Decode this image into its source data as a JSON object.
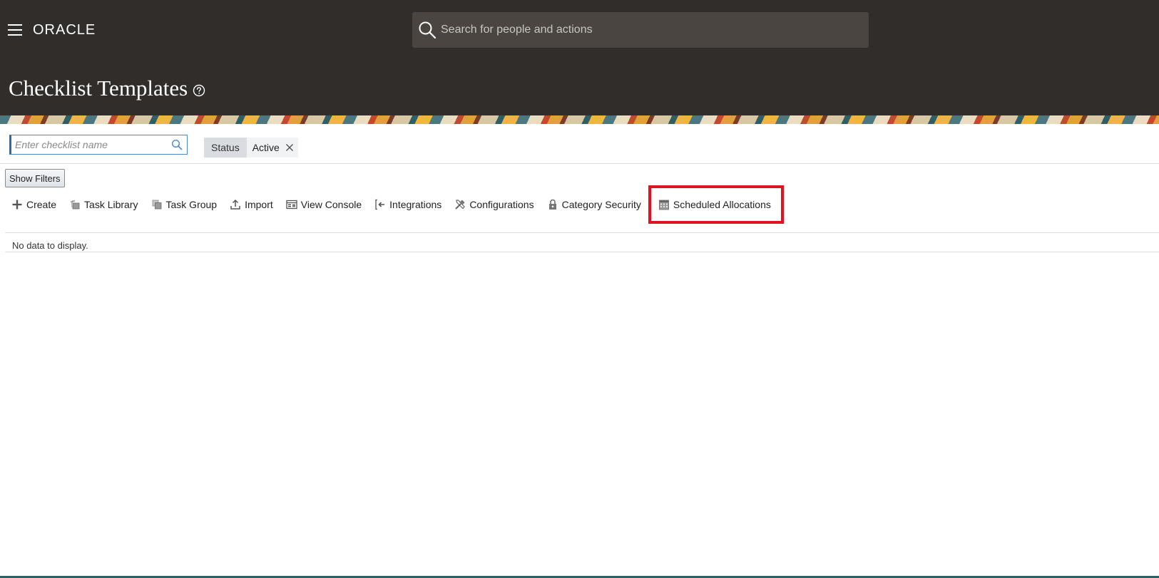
{
  "header": {
    "logo": "ORACLE",
    "search_placeholder": "Search for people and actions",
    "page_title": "Checklist Templates"
  },
  "filters": {
    "checklist_placeholder": "Enter checklist name",
    "chip_key": "Status",
    "chip_value": "Active",
    "show_filters_label": "Show Filters"
  },
  "toolbar": {
    "items": [
      {
        "label": "Create",
        "icon": "plus-icon"
      },
      {
        "label": "Task Library",
        "icon": "task-library-icon"
      },
      {
        "label": "Task Group",
        "icon": "task-group-icon"
      },
      {
        "label": "Import",
        "icon": "import-icon"
      },
      {
        "label": "View Console",
        "icon": "console-icon"
      },
      {
        "label": "Integrations",
        "icon": "integrations-icon"
      },
      {
        "label": "Configurations",
        "icon": "tools-icon"
      },
      {
        "label": "Category Security",
        "icon": "lock-icon"
      },
      {
        "label": "Scheduled Allocations",
        "icon": "calendar-icon"
      }
    ]
  },
  "table": {
    "empty_message": "No data to display."
  },
  "colors": {
    "header_bg": "#312d2a",
    "search_bg": "#4a4541",
    "highlight": "#e0141e"
  }
}
